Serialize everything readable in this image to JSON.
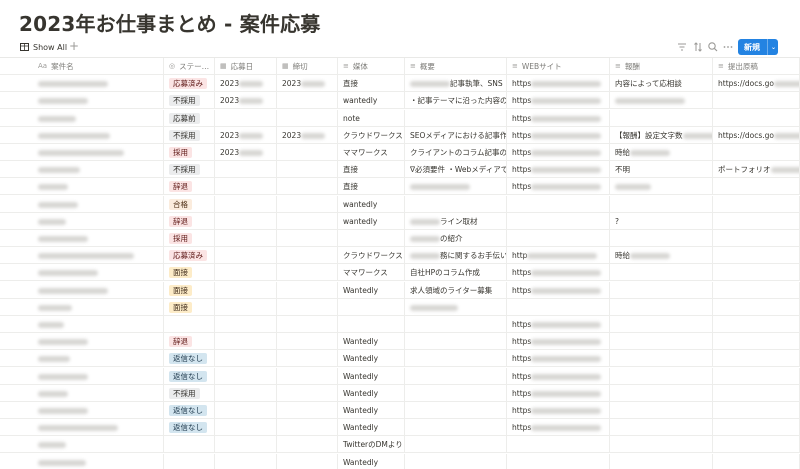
{
  "page": {
    "title": "2023年お仕事まとめ - 案件応募"
  },
  "toolbar": {
    "view_label": "Show All",
    "add_view": "+",
    "new_label": "新規",
    "new_chevron": "⌄"
  },
  "columns": [
    {
      "label": "案件名",
      "icon": "Aa"
    },
    {
      "label": "ステー…",
      "icon": "◎"
    },
    {
      "label": "応募日",
      "icon": "▦"
    },
    {
      "label": "締切",
      "icon": "▦"
    },
    {
      "label": "媒体",
      "icon": "≡"
    },
    {
      "label": "概要",
      "icon": "≡"
    },
    {
      "label": "WEBサイト",
      "icon": "≡"
    },
    {
      "label": "報酬",
      "icon": "≡"
    },
    {
      "label": "提出原稿",
      "icon": "≡"
    }
  ],
  "status_colors": {
    "応募済み": {
      "bg": "#fbe4e4",
      "fg": "#5d1715"
    },
    "不採用": {
      "bg": "#ebeced",
      "fg": "#32302c"
    },
    "応募前": {
      "bg": "#ebeced",
      "fg": "#32302c"
    },
    "採用": {
      "bg": "#fbe4e4",
      "fg": "#5d1715"
    },
    "辞退": {
      "bg": "#fbe4e4",
      "fg": "#5d1715"
    },
    "合格": {
      "bg": "#fbecdd",
      "fg": "#49290e"
    },
    "面接": {
      "bg": "#fdecc8",
      "fg": "#402c1b"
    },
    "返信なし": {
      "bg": "#d3e5ef",
      "fg": "#183347"
    }
  },
  "rows": [
    {
      "status": "応募済み",
      "date1": "2023",
      "date2": "2023",
      "media": "直接",
      "summary": "記事執筆、SNS",
      "web": "https",
      "pay": "内容によって応相談",
      "draft": "https://docs.go"
    },
    {
      "status": "不採用",
      "date1": "2023",
      "date2": "",
      "media": "wantedly",
      "summary": "・記事テーマに沿った内容の執",
      "web": "https",
      "pay": "",
      "draft": ""
    },
    {
      "status": "応募前",
      "date1": "",
      "date2": "",
      "media": "note",
      "summary": "",
      "web": "https",
      "pay": "",
      "draft": ""
    },
    {
      "status": "不採用",
      "date1": "2023",
      "date2": "2023",
      "media": "クラウドワークス",
      "summary": "SEOメディアにおける記事作成",
      "web": "https",
      "pay": "【報酬】設定文字数",
      "draft": "https://docs.go"
    },
    {
      "status": "採用",
      "date1": "2023",
      "date2": "",
      "media": "ママワークス",
      "summary": "クライアントのコラム記事のご",
      "web": "https",
      "pay": "時給",
      "draft": ""
    },
    {
      "status": "不採用",
      "date1": "",
      "date2": "",
      "media": "直接",
      "summary": "∇必須要件 ・Webメディアで1",
      "web": "https",
      "pay": "不明",
      "draft": "ポートフォリオ"
    },
    {
      "status": "辞退",
      "date1": "",
      "date2": "",
      "media": "直接",
      "summary": "",
      "web": "https",
      "pay": "",
      "draft": ""
    },
    {
      "status": "合格",
      "date1": "",
      "date2": "",
      "media": "wantedly",
      "summary": "",
      "web": "",
      "pay": "",
      "draft": ""
    },
    {
      "status": "辞退",
      "date1": "",
      "date2": "",
      "media": "wantedly",
      "summary": "ライン取材",
      "web": "",
      "pay": "?",
      "draft": ""
    },
    {
      "status": "採用",
      "date1": "",
      "date2": "",
      "media": "",
      "summary": "の紹介",
      "web": "",
      "pay": "",
      "draft": ""
    },
    {
      "status": "応募済み",
      "date1": "",
      "date2": "",
      "media": "クラウドワークス",
      "summary": "務に関するお手伝い",
      "web": "http",
      "pay": "時給",
      "draft": ""
    },
    {
      "status": "面接",
      "date1": "",
      "date2": "",
      "media": "ママワークス",
      "summary": "自社HPのコラム作成",
      "web": "https",
      "pay": "",
      "draft": ""
    },
    {
      "status": "面接",
      "date1": "",
      "date2": "",
      "media": "Wantedly",
      "summary": "求人領域のライター募集",
      "web": "https",
      "pay": "",
      "draft": ""
    },
    {
      "status": "面接",
      "date1": "",
      "date2": "",
      "media": "",
      "summary": "",
      "web": "",
      "pay": "",
      "draft": ""
    },
    {
      "status": "",
      "date1": "",
      "date2": "",
      "media": "",
      "summary": "",
      "web": "https",
      "pay": "",
      "draft": ""
    },
    {
      "status": "辞退",
      "date1": "",
      "date2": "",
      "media": "Wantedly",
      "summary": "",
      "web": "https",
      "pay": "",
      "draft": ""
    },
    {
      "status": "返信なし",
      "date1": "",
      "date2": "",
      "media": "Wantedly",
      "summary": "",
      "web": "https",
      "pay": "",
      "draft": ""
    },
    {
      "status": "返信なし",
      "date1": "",
      "date2": "",
      "media": "Wantedly",
      "summary": "",
      "web": "https",
      "pay": "",
      "draft": ""
    },
    {
      "status": "不採用",
      "date1": "",
      "date2": "",
      "media": "Wantedly",
      "summary": "",
      "web": "https",
      "pay": "",
      "draft": ""
    },
    {
      "status": "返信なし",
      "date1": "",
      "date2": "",
      "media": "Wantedly",
      "summary": "",
      "web": "https",
      "pay": "",
      "draft": ""
    },
    {
      "status": "返信なし",
      "date1": "",
      "date2": "",
      "media": "Wantedly",
      "summary": "",
      "web": "https",
      "pay": "",
      "draft": ""
    },
    {
      "status": "",
      "date1": "",
      "date2": "",
      "media": "TwitterのDMより",
      "summary": "",
      "web": "",
      "pay": "",
      "draft": ""
    },
    {
      "status": "",
      "date1": "",
      "date2": "",
      "media": "Wantedly",
      "summary": "",
      "web": "",
      "pay": "",
      "draft": ""
    }
  ]
}
